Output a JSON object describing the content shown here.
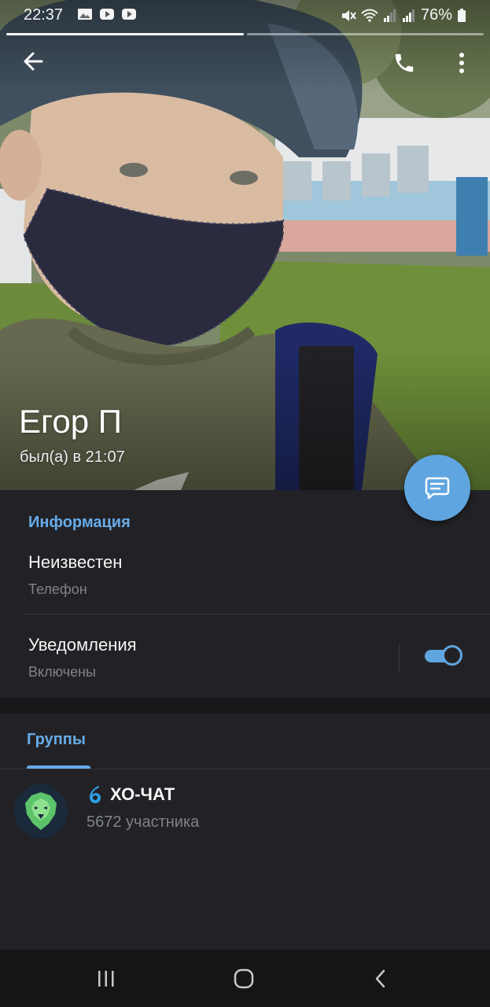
{
  "status_bar": {
    "time": "22:37",
    "battery": "76%",
    "icons": [
      "gallery-icon",
      "youtube-icon",
      "youtube-icon",
      "mute-icon",
      "wifi-icon",
      "signal-icon",
      "signal-icon",
      "battery-icon"
    ]
  },
  "story": {
    "segments": 2,
    "active_segment": 1
  },
  "toolbar": {
    "back_icon": "arrow-left-icon",
    "call_icon": "phone-icon",
    "more_icon": "more-vertical-icon"
  },
  "profile": {
    "name": "Егор П",
    "status": "был(а) в 21:07"
  },
  "fab": {
    "icon": "message-icon"
  },
  "info": {
    "title": "Информация",
    "phone_value": "Неизвестен",
    "phone_label": "Телефон",
    "notifications_title": "Уведомления",
    "notifications_sub": "Включены",
    "notifications_on": true
  },
  "groups": {
    "tab_label": "Группы",
    "items": [
      {
        "name": "ХО-ЧАТ",
        "members": "5672 участника",
        "avatar_icon": "lion-logo",
        "badge_icon": "six-logo-icon"
      }
    ]
  },
  "nav": {
    "recents_icon": "recents-icon",
    "home_icon": "home-icon",
    "back_icon": "nav-back-icon"
  },
  "colors": {
    "accent": "#5fa6e0",
    "section_title": "#67abe8",
    "background": "#222226",
    "subtext": "#7e8389"
  }
}
